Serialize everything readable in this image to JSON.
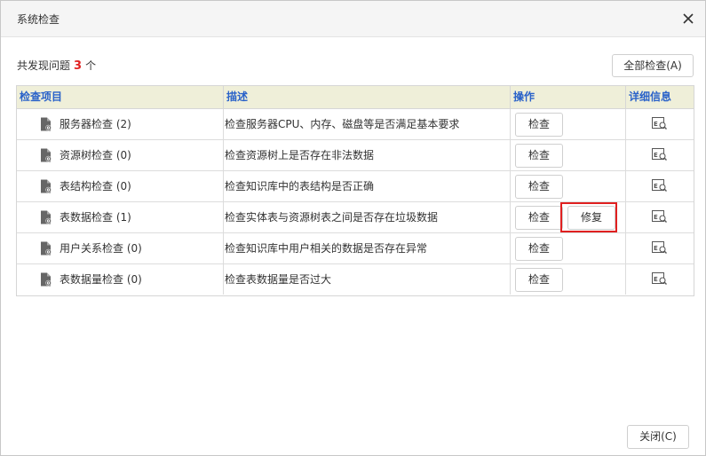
{
  "dialog": {
    "title": "系统检查",
    "close_icon": "close-icon"
  },
  "summary": {
    "prefix": "共发现问题",
    "count": "3",
    "suffix": "个"
  },
  "toolbar": {
    "check_all_label": "全部检查(A)"
  },
  "table": {
    "headers": {
      "item": "检查项目",
      "desc": "描述",
      "action": "操作",
      "detail": "详细信息"
    },
    "rows": [
      {
        "label": "服务器检查 (2)",
        "desc": "检查服务器CPU、内存、磁盘等是否满足基本要求",
        "check_label": "检查"
      },
      {
        "label": "资源树检查 (0)",
        "desc": "检查资源树上是否存在非法数据",
        "check_label": "检查"
      },
      {
        "label": "表结构检查 (0)",
        "desc": "检查知识库中的表结构是否正确",
        "check_label": "检查"
      },
      {
        "label": "表数据检查 (1)",
        "desc": "检查实体表与资源树表之间是否存在垃圾数据",
        "check_label": "检查",
        "fix_label": "修复"
      },
      {
        "label": "用户关系检查 (0)",
        "desc": "检查知识库中用户相关的数据是否存在异常",
        "check_label": "检查"
      },
      {
        "label": "表数据量检查 (0)",
        "desc": "检查表数据量是否过大",
        "check_label": "检查"
      }
    ]
  },
  "footer": {
    "close_label": "关闭(C)"
  },
  "colors": {
    "header_bg": "#efefd9",
    "header_text": "#2a62c9",
    "count_red": "#e02020",
    "highlight_red": "#e02020"
  },
  "icons": {
    "item": "document-gear-icon",
    "detail": "detail-view-icon"
  }
}
